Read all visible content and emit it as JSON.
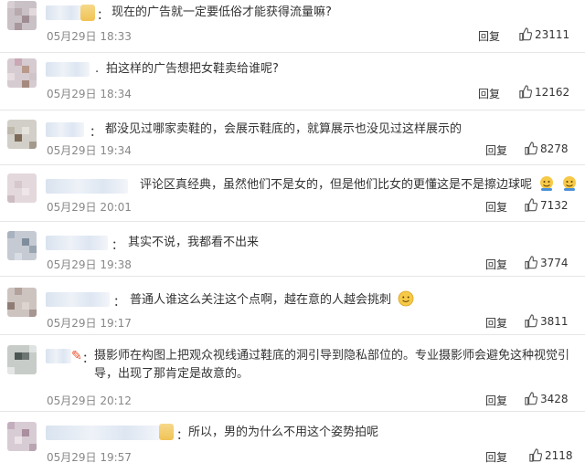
{
  "comments": [
    {
      "text": "现在的广告就一定要低俗才能获得流量嘛?",
      "time": "05月29日 18:33",
      "reply": "回复",
      "likes": "23111",
      "separator": "："
    },
    {
      "text": "拍这样的广告想把女鞋卖给谁呢?",
      "time": "05月29日 18:34",
      "reply": "回复",
      "likes": "12162",
      "separator": "."
    },
    {
      "text": "都没见过哪家卖鞋的，会展示鞋底的，就算展示也没见过这样展示的",
      "time": "05月29日 19:34",
      "reply": "回复",
      "likes": "8278",
      "separator": "："
    },
    {
      "text": "评论区真经典，虽然他们不是女的，但是他们比女的更懂这是不是擦边球呢",
      "time": "05月29日 20:01",
      "reply": "回复",
      "likes": "7132",
      "separator": ""
    },
    {
      "text": "其实不说，我都看不出来",
      "time": "05月29日 19:38",
      "reply": "回复",
      "likes": "3774",
      "separator": "："
    },
    {
      "text": "普通人谁这么关注这个点啊，越在意的人越会挑刺",
      "time": "05月29日 19:17",
      "reply": "回复",
      "likes": "3811",
      "separator": "："
    },
    {
      "text": "摄影师在构图上把观众视线通过鞋底的洞引导到隐私部位的。专业摄影师会避免这种视觉引导，出现了那肯定是故意的。",
      "time": "05月29日 20:12",
      "reply": "回复",
      "likes": "3428",
      "separator": "："
    },
    {
      "text": "所以，男的为什么不用这个姿势拍呢",
      "time": "05月29日 19:57",
      "reply": "回复",
      "likes": "2118",
      "separator": "："
    }
  ],
  "icons": {
    "like": "thumbs-up-icon",
    "emoji": "smiley-icon",
    "avatar": "pixelated-avatar"
  },
  "colors": {
    "username_blur": "#dde6f2",
    "time_gray": "#888888",
    "text": "#333333",
    "divider": "#e6e6e6"
  }
}
